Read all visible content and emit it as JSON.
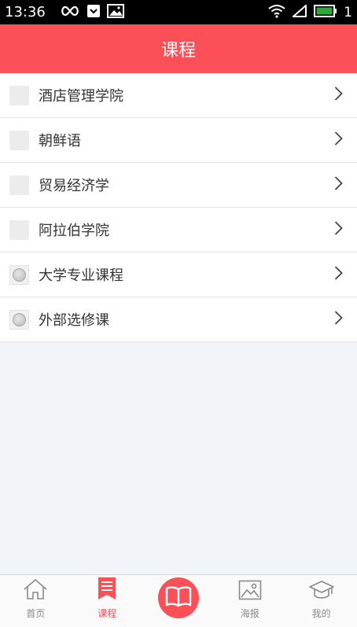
{
  "status_bar": {
    "time": "13:36",
    "battery_level": "1"
  },
  "header": {
    "title": "课程"
  },
  "courses": [
    {
      "label": "酒店管理学院",
      "thumb": "plain"
    },
    {
      "label": "朝鲜语",
      "thumb": "plain"
    },
    {
      "label": "贸易经济学",
      "thumb": "plain"
    },
    {
      "label": "阿拉伯学院",
      "thumb": "plain"
    },
    {
      "label": "大学专业课程",
      "thumb": "image"
    },
    {
      "label": "外部选修课",
      "thumb": "image"
    }
  ],
  "tabbar": {
    "home": "首页",
    "courses": "课程",
    "posters": "海报",
    "mine": "我的"
  },
  "colors": {
    "accent": "#fb5058",
    "background": "#f1f5fa"
  }
}
